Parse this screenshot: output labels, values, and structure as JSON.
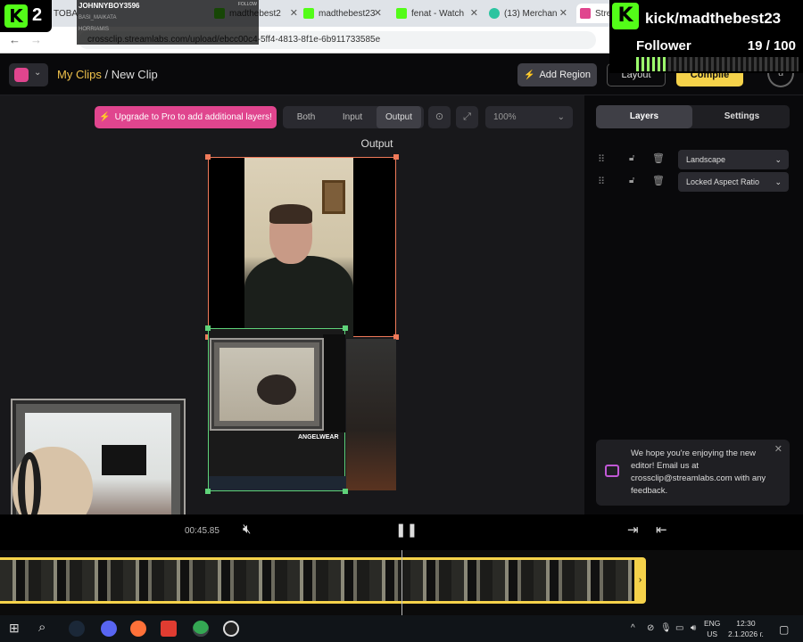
{
  "browser": {
    "tabs": [
      {
        "label": "TOBA",
        "color": "#e0458e"
      },
      {
        "label": "",
        "color": "#53fc18"
      },
      {
        "label": "madthebest2",
        "color": "#53fc18"
      },
      {
        "label": "madthebest23",
        "color": "#53fc18"
      },
      {
        "label": "fenat - Watch",
        "color": "#53fc18"
      },
      {
        "label": "(13) Merchan",
        "color": "#2bc4a0"
      },
      {
        "label": "Strea",
        "color": "#e0458e"
      }
    ],
    "url": "crossclip.streamlabs.com/upload/ebcc00c4-5ff4-4813-8f1e-6b911733585e"
  },
  "kick_overlay": {
    "left_count": "2",
    "chat": {
      "username": "JOHNNYBOY3596",
      "follow_label": "FOLLOW",
      "rows": [
        "BASI_MAIKATA",
        "HORRIAMIS",
        "ANGELWEAR"
      ]
    },
    "channel": "kick/madthebest23",
    "follower_label": "Follower",
    "follower_count": "19 / 100",
    "follower_progress": 0.19
  },
  "app": {
    "breadcrumb_root": "My Clips",
    "breadcrumb_sep": " / ",
    "breadcrumb_current": "New Clip",
    "add_region": "Add Region",
    "layout": "Layout",
    "compile": "Compile",
    "avatar_letter": "u"
  },
  "editor": {
    "upgrade": "Upgrade to Pro to add additional layers!",
    "view_modes": [
      "Both",
      "Input",
      "Output"
    ],
    "view_active": "Output",
    "zoom": "100%",
    "output_label": "Output",
    "inner_text": "ANGELWEAR"
  },
  "panel": {
    "tabs": [
      "Layers",
      "Settings"
    ],
    "active_tab": "Layers",
    "layers": [
      {
        "name": "Landscape"
      },
      {
        "name": "Locked Aspect Ratio"
      }
    ],
    "toast": "We hope you're enjoying the new editor! Email us at crossclip@streamlabs.com with any feedback."
  },
  "player": {
    "timecode": "00:45.85"
  },
  "taskbar": {
    "lang": "ENG",
    "region": "US",
    "time": "12:30",
    "date": "2.1.2026 г."
  },
  "colors": {
    "accent_pink": "#e0458e",
    "accent_yellow": "#f5d24a",
    "kick_green": "#53fc18",
    "output_border": "#f07a5a",
    "input_border": "#5fd37a"
  }
}
